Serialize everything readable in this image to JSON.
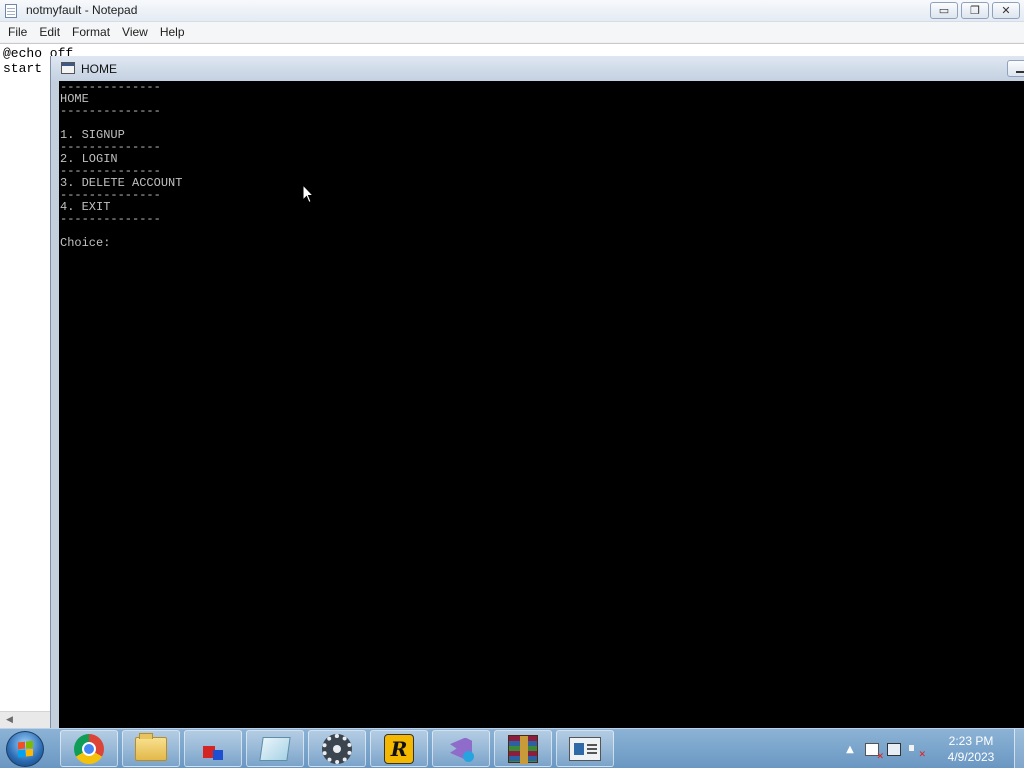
{
  "notepad": {
    "title": "notmyfault - Notepad",
    "menu": [
      "File",
      "Edit",
      "Format",
      "View",
      "Help"
    ],
    "lines": [
      "@echo off",
      "start"
    ],
    "caption_buttons": {
      "minimize": "▭",
      "restore": "❐",
      "close": "✕"
    }
  },
  "console": {
    "title": "HOME",
    "lines": [
      "--------------",
      "HOME",
      "--------------",
      "",
      "1. SIGNUP",
      "--------------",
      "2. LOGIN",
      "--------------",
      "3. DELETE ACCOUNT",
      "--------------",
      "4. EXIT",
      "--------------",
      "",
      "Choice: "
    ]
  },
  "taskbar": {
    "apps": [
      "chrome-icon",
      "file-explorer-icon",
      "3d-cube-app-icon",
      "notepad-icon",
      "settings-gear-icon",
      "rockstar-launcher-icon",
      "visual-studio-installer-icon",
      "winrar-icon",
      "window-app-icon"
    ],
    "clock": {
      "time": "2:23 PM",
      "date": "4/9/2023"
    }
  }
}
